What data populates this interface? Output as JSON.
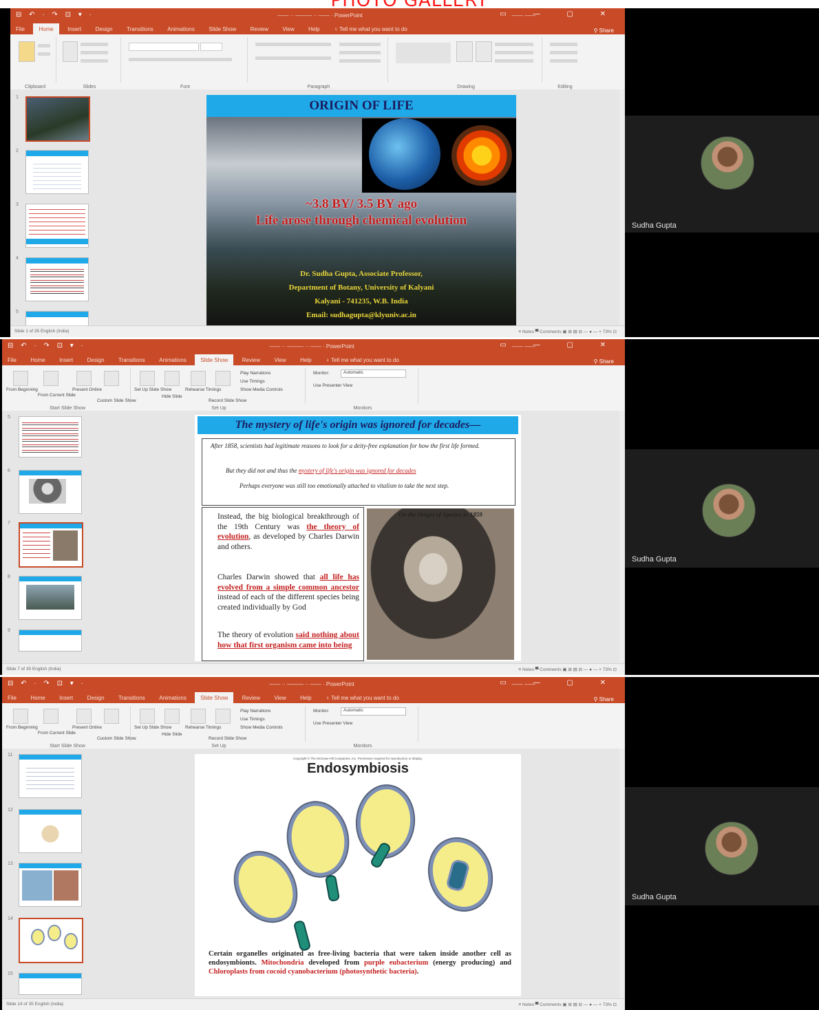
{
  "page": {
    "header": "PHOTO GALLERY"
  },
  "powerpoint": {
    "qat": "⊟ ↶ · ↷ ⊡ ▾ ·",
    "window_controls": "▭ — ▢ ✕",
    "tabs_home": [
      "File",
      "Home",
      "Insert",
      "Design",
      "Transitions",
      "Animations",
      "Slide Show",
      "Review",
      "View",
      "Help",
      "♀ Tell me what you want to do"
    ],
    "tabs_show": [
      "File",
      "Home",
      "Insert",
      "Design",
      "Transitions",
      "Animations",
      "Slide Show",
      "Review",
      "View",
      "Help",
      "♀ Tell me what you want to do"
    ],
    "share": "⚲ Share",
    "slideshow_ribbon": {
      "start_from_beginning": "From Beginning",
      "from_current": "From Current Slide",
      "present_online": "Present Online",
      "custom_show": "Custom Slide Show",
      "group_start": "Start Slide Show",
      "set_up": "Set Up Slide Show",
      "hide_slide": "Hide Slide",
      "rehearse": "Rehearse Timings",
      "record": "Record Slide Show",
      "play_narrations": "Play Narrations",
      "use_timings": "Use Timings",
      "show_media": "Show Media Controls",
      "group_setup": "Set Up",
      "monitor_label": "Monitor:",
      "monitor_value": "Automatic",
      "presenter_view": "Use Presenter View",
      "group_monitors": "Monitors"
    },
    "home_groups": [
      "Clipboard",
      "Slides",
      "Font",
      "Paragraph",
      "Drawing",
      "Editing"
    ]
  },
  "participant": {
    "name": "Sudha Gupta"
  },
  "slide1": {
    "title": "ORIGIN OF LIFE",
    "line1": "~3.8 BY/ 3.5 BY ago",
    "line2": "Life arose through chemical evolution",
    "author1": "Dr. Sudha Gupta, Associate Professor,",
    "author2": "Department of Botany, University of Kalyani",
    "author3": "Kalyani - 741235, W.B. India",
    "author4": "Email: sudhagupta@klyuniv.ac.in"
  },
  "slide2": {
    "title": "The mystery of life's origin was ignored for decades—",
    "bullet1": "After 1858, scientists had legitimate reasons to look for a deity-free explanation for how the first life formed.",
    "bullet2_pre": "But they did not and thus the ",
    "bullet2_red": "mystery of life's origin was ignored for decades",
    "bullet3": "Perhaps everyone was still too emotionally attached to vitalism to take the next step.",
    "b4_pre": "Instead, the big biological breakthrough of the 19th Century was ",
    "b4_red": "the theory of evolution",
    "b4_post": ", as developed by Charles Darwin and others.",
    "b5_pre": "Charles Darwin showed that ",
    "b5_red": "all life has evolved from a simple common ancestor",
    "b5_post": " instead of each of the different species being created individually by God",
    "b6_pre": "The theory of evolution ",
    "b6_red": "said nothing about how that first organism came into being",
    "caption": "On the Origin of Species in 1859"
  },
  "slide3": {
    "copyright": "Copyright © The McGraw-Hill Companies, Inc. Permission required for reproduction or display.",
    "title": "Endosymbiosis",
    "text_pre": "Certain organelles originated as free-living bacteria that were taken inside another cell as endosymbionts. ",
    "text_red1": "Mitochondria",
    "text_mid": " developed from ",
    "text_red2": "purple eubacterium",
    "text_mid2": " (energy producing) and ",
    "text_red3": "Chloroplasts from cocoid cyanobacterium (photosynthetic bacteria)",
    "text_end": "."
  },
  "thumbs": {
    "s1": [
      "1",
      "2",
      "3",
      "4",
      "5"
    ],
    "s2": [
      "5",
      "6",
      "7",
      "8",
      "9"
    ],
    "s3": [
      "11",
      "12",
      "13",
      "14",
      "15"
    ]
  },
  "status": {
    "s1_left": "Slide 1 of 35    English (India)",
    "s2_left": "Slide 7 of 35    English (India)",
    "s3_left": "Slide 14 of 35    English (India)",
    "right": "≡ Notes   ▀ Comments   ▣ ⊞ ▤ ⊟   — ● — +   73%   ⊡"
  }
}
